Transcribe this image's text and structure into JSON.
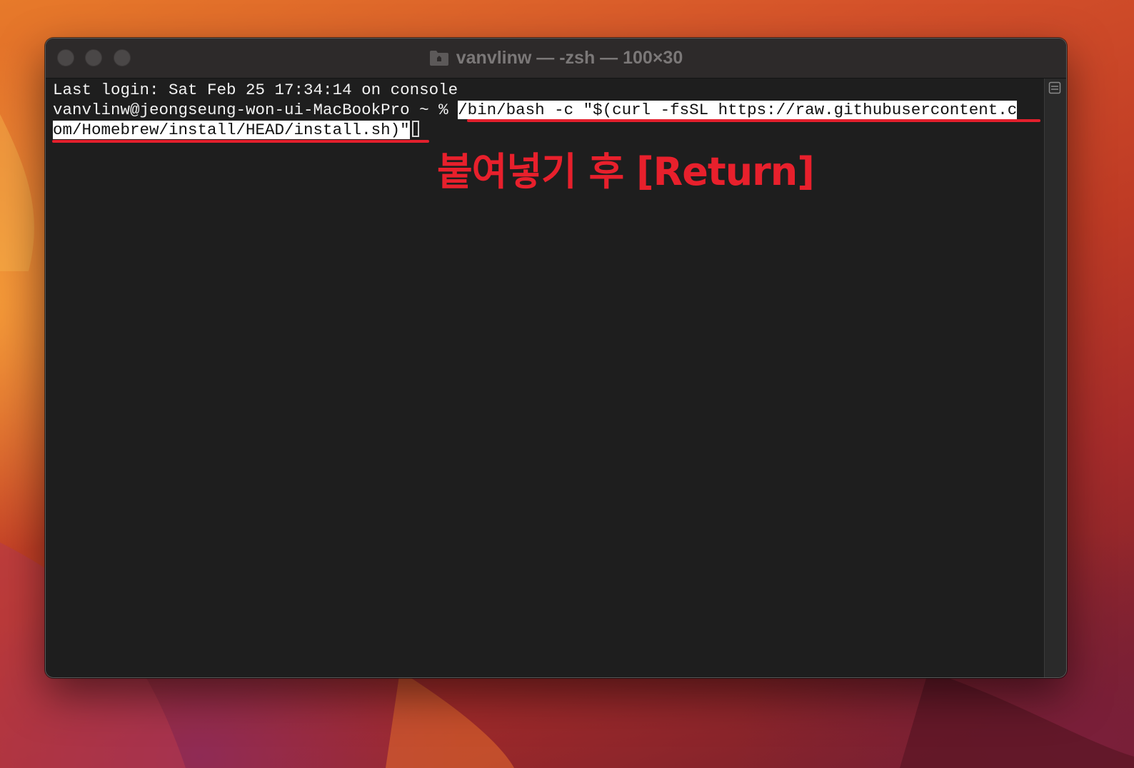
{
  "window": {
    "title": "vanvlinw — -zsh — 100×30",
    "folder_icon": "folder-icon",
    "traffic_lights": [
      "close-button",
      "minimize-button",
      "zoom-button"
    ]
  },
  "terminal": {
    "last_login": "Last login: Sat Feb 25 17:34:14 on console",
    "prompt": "vanvlinw@jeongseung-won-ui-MacBookPro ~ % ",
    "command_line1": "/bin/bash -c \"$(curl -fsSL https://raw.githubusercontent.c",
    "command_line2": "om/Homebrew/install/HEAD/install.sh)\""
  },
  "annotation": {
    "text": "붙여넣기 후 [Return]",
    "color": "#e8202c"
  },
  "colors": {
    "terminal_bg": "#1e1e1e",
    "titlebar_bg": "#2d2a2a",
    "highlight": "#e3202d"
  }
}
